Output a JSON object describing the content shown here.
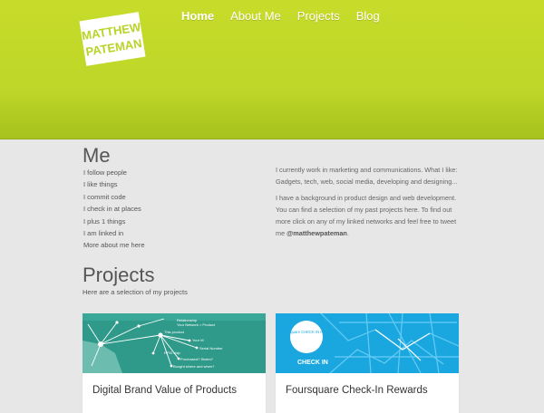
{
  "logo": {
    "line1": "MATTHEW",
    "line2": "PATEMAN"
  },
  "nav": {
    "items": [
      {
        "label": "Home",
        "active": true
      },
      {
        "label": "About Me",
        "active": false
      },
      {
        "label": "Projects",
        "active": false
      },
      {
        "label": "Blog",
        "active": false
      }
    ]
  },
  "me": {
    "title": "Me",
    "links": [
      "I follow people",
      "I like things",
      "I commit code",
      "I check in at places",
      "I plus 1 things",
      "I am linked in",
      "More about me here"
    ]
  },
  "about": {
    "paragraph1": "I currently work in marketing and communications. What I like: Gadgets, tech, web, social media, developing and designing...",
    "paragraph2": "I have a background in product design and web development. You can find a selection of my past projects here. To find out more click on any of my linked networks and feel free to tweet me",
    "handle": "@matthewpateman",
    "end": "."
  },
  "projects": {
    "title": "Projects",
    "subtitle": "Here are a selection of my projects",
    "cards": [
      {
        "title": "Digital Brand Value of Products",
        "diagram_labels": [
          "Relationship",
          "Your Network > Product",
          "This product",
          "Your M",
          "Serial Number",
          "Bought where and when?",
          "Purchased? Stolen?",
          "RFID chip"
        ]
      },
      {
        "title": "Foursquare Check-In Rewards",
        "badge": "foursquare\nCHECK IN\nHERE",
        "checkin": "CHECK IN"
      }
    ]
  },
  "colors": {
    "header": "#c2da29",
    "card1_bg": "#2f9a8a",
    "card2_bg": "#1aa7e0"
  }
}
